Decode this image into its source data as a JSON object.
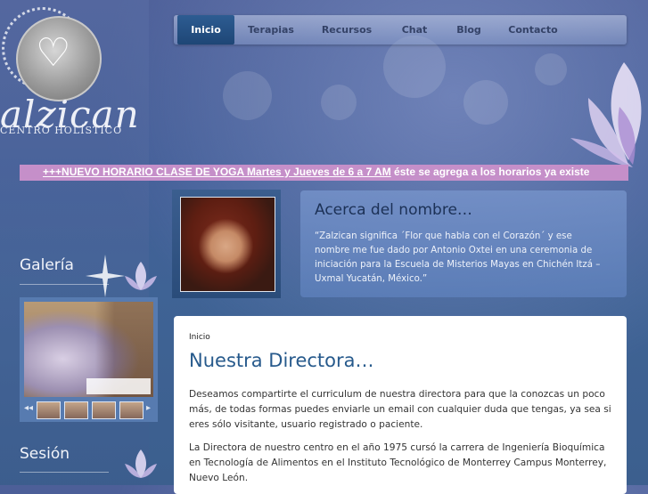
{
  "brand": {
    "name": "alzican",
    "tagline": "CENTRO HOLÍSTICO"
  },
  "nav": {
    "items": [
      {
        "label": "Inicio",
        "active": true
      },
      {
        "label": "Terapias",
        "active": false
      },
      {
        "label": "Recursos",
        "active": false
      },
      {
        "label": "Chat",
        "active": false
      },
      {
        "label": "Blog",
        "active": false
      },
      {
        "label": "Contacto",
        "active": false
      }
    ]
  },
  "announcement": {
    "link_text": "+++NUEVO HORARIO CLASE DE YOGA Martes y Jueves de 6 a 7 AM",
    "rest_text": " éste se agrega a los horarios ya existe"
  },
  "about": {
    "title": "Acerca del nombre…",
    "text": "“Zalzican significa ´Flor que habla con el Corazón´ y ese nombre me fue dado por Antonio Oxtei en una ceremonia de iniciación para la Escuela de Misterios Mayas en Chichén Itzá – Uxmal Yucatán, México.”"
  },
  "sidebar": {
    "gallery_title": "Galería",
    "session_title": "Sesión"
  },
  "main": {
    "breadcrumb": "Inicio",
    "title": "Nuestra Directora…",
    "paragraph1": "Deseamos compartirte el curriculum de nuestra directora para que la conozcas un poco más, de todas formas puedes enviarle un email con cualquier duda que tengas, ya sea si eres sólo visitante, usuario registrado o paciente.",
    "paragraph2": "La Directora de nuestro centro en el año 1975 cursó la carrera de Ingeniería Bioquímica en Tecnología de Alimentos en el Instituto Tecnológico de  Monterrey Campus Monterrey, Nuevo León."
  },
  "colors": {
    "accent": "#275a8c",
    "marquee_bg": "#c58fc9",
    "nav_active": "#1e4676"
  },
  "icons": [
    "heart-lotus-logo-icon",
    "lotus-flower-icon",
    "sparkle-icon",
    "arrow-left-icon",
    "arrow-right-icon"
  ]
}
